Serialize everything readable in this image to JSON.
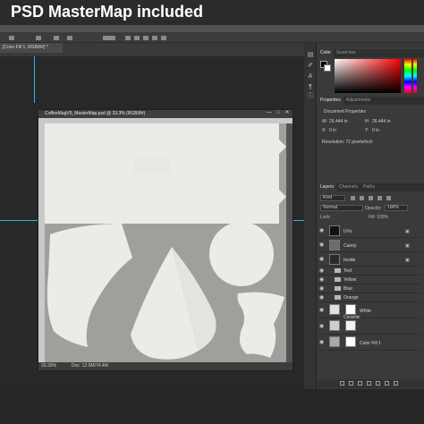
{
  "banner": {
    "text": "PSD MasterMap included"
  },
  "document_tab": {
    "label": "[Color Fill 1, RGB/8#] *"
  },
  "document_window": {
    "title": "CoffeeMugV5_MasterMap.psd @ 33.3% (RGB/8#)",
    "buttons": [
      "—",
      "□",
      "✕"
    ],
    "zoom": "33.33%",
    "doc_size": "Doc: 12.0M/74.4M"
  },
  "color_panel": {
    "tabs": [
      "Color",
      "Swatches"
    ]
  },
  "properties_panel": {
    "tabs": [
      "Properties",
      "Adjustments"
    ],
    "heading": "Document Properties",
    "width_label": "W:",
    "width_value": "26.444 in",
    "height_label": "H:",
    "height_value": "26.444 in",
    "x_label": "X:",
    "x_value": "0 in",
    "y_label": "Y:",
    "y_value": "0 in",
    "resolution": "Resolution: 72 pixels/inch"
  },
  "layers_panel": {
    "tabs": [
      "Layers",
      "Channels",
      "Paths"
    ],
    "kind": "Kind",
    "blend_mode": "Normal",
    "opacity_label": "Opacity:",
    "opacity_value": "100%",
    "lock_label": "Lock:",
    "fill_label": "Fill: 100%",
    "layers": [
      {
        "name": "UVs"
      },
      {
        "name": "Candy"
      },
      {
        "name": "Inside"
      },
      {
        "name": "Text"
      },
      {
        "name": "Yellow"
      },
      {
        "name": "Blue"
      },
      {
        "name": "Orange"
      },
      {
        "name": "White"
      },
      {
        "name": "Ceramic"
      },
      {
        "name": "Color Fill 1"
      }
    ]
  },
  "colors": {
    "banner_text": "#ffffff",
    "canvas_gray": "#a6a6a6",
    "uv_piece": "#ebebe8",
    "guide": "#29b6e8"
  }
}
